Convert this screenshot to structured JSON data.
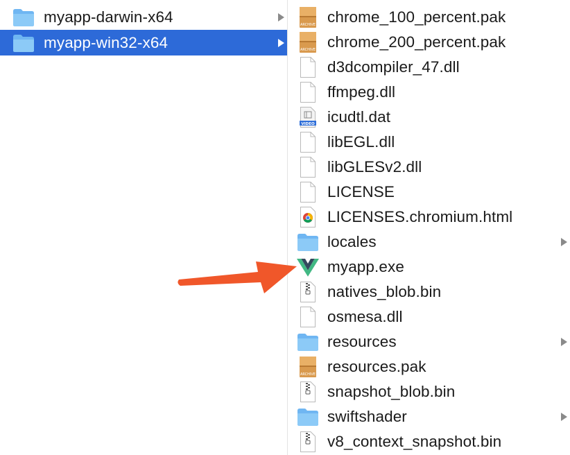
{
  "left_column": {
    "items": [
      {
        "label": "myapp-darwin-x64",
        "icon": "folder-icon",
        "selected": false
      },
      {
        "label": "myapp-win32-x64",
        "icon": "folder-icon",
        "selected": true
      }
    ]
  },
  "right_column": {
    "items": [
      {
        "label": "chrome_100_percent.pak",
        "icon": "archive-icon"
      },
      {
        "label": "chrome_200_percent.pak",
        "icon": "archive-icon"
      },
      {
        "label": "d3dcompiler_47.dll",
        "icon": "document-icon"
      },
      {
        "label": "ffmpeg.dll",
        "icon": "document-icon"
      },
      {
        "label": "icudtl.dat",
        "icon": "video-file-icon",
        "badge": "VIDEO"
      },
      {
        "label": "libEGL.dll",
        "icon": "document-icon"
      },
      {
        "label": "libGLESv2.dll",
        "icon": "document-icon"
      },
      {
        "label": "LICENSE",
        "icon": "document-icon"
      },
      {
        "label": "LICENSES.chromium.html",
        "icon": "chrome-html-icon"
      },
      {
        "label": "locales",
        "icon": "folder-icon"
      },
      {
        "label": "myapp.exe",
        "icon": "vue-logo-icon"
      },
      {
        "label": "natives_blob.bin",
        "icon": "zip-file-icon"
      },
      {
        "label": "osmesa.dll",
        "icon": "document-icon"
      },
      {
        "label": "resources",
        "icon": "folder-icon"
      },
      {
        "label": "resources.pak",
        "icon": "archive-icon"
      },
      {
        "label": "snapshot_blob.bin",
        "icon": "zip-file-icon"
      },
      {
        "label": "swiftshader",
        "icon": "folder-icon"
      },
      {
        "label": "v8_context_snapshot.bin",
        "icon": "zip-file-icon"
      }
    ]
  },
  "archive_badge": "ARCHIVE",
  "colors": {
    "selection": "#2d6ad8",
    "folder": "#6fb6f2",
    "arrow": "#f0572a",
    "vue_green": "#41b883",
    "vue_dark": "#35495e"
  }
}
